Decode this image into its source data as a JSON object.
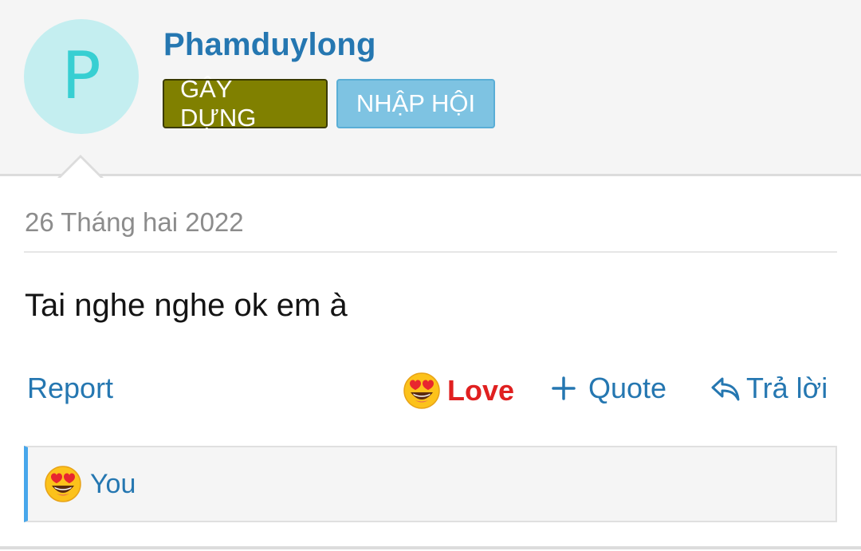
{
  "post": {
    "avatar_letter": "P",
    "username": "Phamduylong",
    "badges": [
      {
        "label": "GÂY DỰNG",
        "color": "#808000"
      },
      {
        "label": "NHẬP HỘI",
        "color": "#7ec3e2"
      }
    ],
    "date": "26 Tháng hai 2022",
    "message": "Tai nghe nghe ok em à"
  },
  "actions": {
    "report_label": "Report",
    "love_label": "Love",
    "quote_label": "Quote",
    "reply_label": "Trả lời"
  },
  "reactions": {
    "summary_label": "You",
    "emoji": "heart-eyes-emoji-icon"
  },
  "colors": {
    "link": "#2577b1",
    "love": "#e02020",
    "header_bg": "#f5f5f5",
    "accent_bar": "#47a7eb"
  }
}
